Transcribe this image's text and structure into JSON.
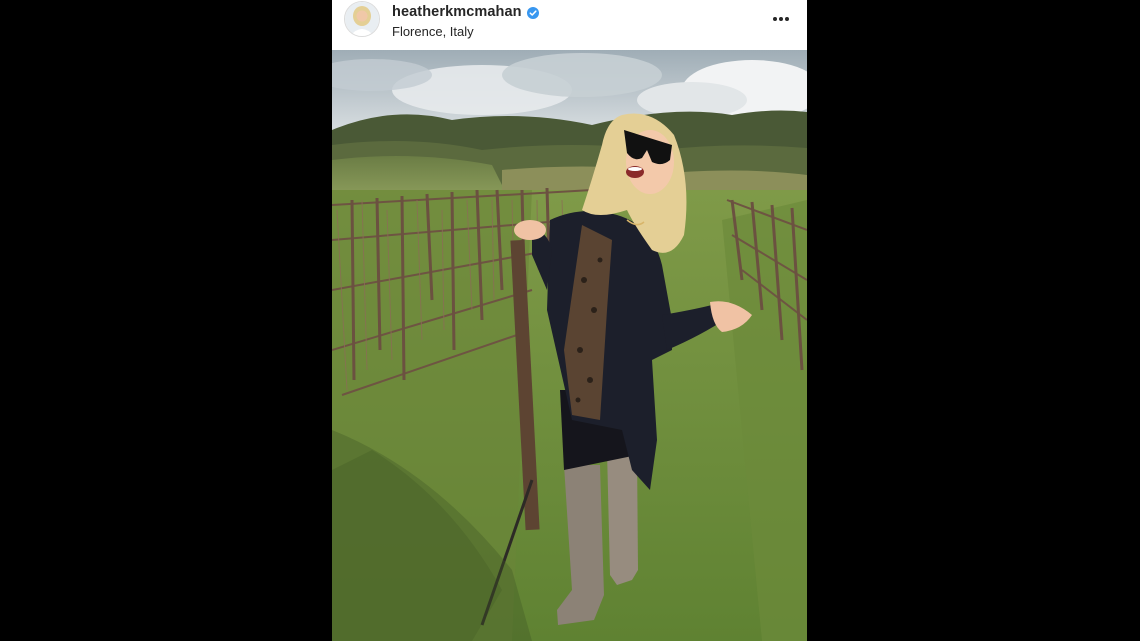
{
  "post": {
    "username": "heatherkmcmahan",
    "verified": true,
    "location": "Florence, Italy",
    "more_icon": "more-horizontal-icon",
    "avatar_icon": "profile-avatar"
  },
  "photo": {
    "kind": "vineyard-portrait",
    "palette": {
      "sky_top": "#a9b6bf",
      "cloud": "#eef0f1",
      "hills": "#4c5a37",
      "grass": "#6d8f3c",
      "vines": "#7a5e46",
      "coat": "#1c1f2b",
      "hair": "#e4cf95",
      "boots": "#8c8276"
    }
  },
  "colors": {
    "background": "#000000",
    "header_bg": "#ffffff",
    "text": "#262626",
    "verified_badge": "#3897f0"
  }
}
